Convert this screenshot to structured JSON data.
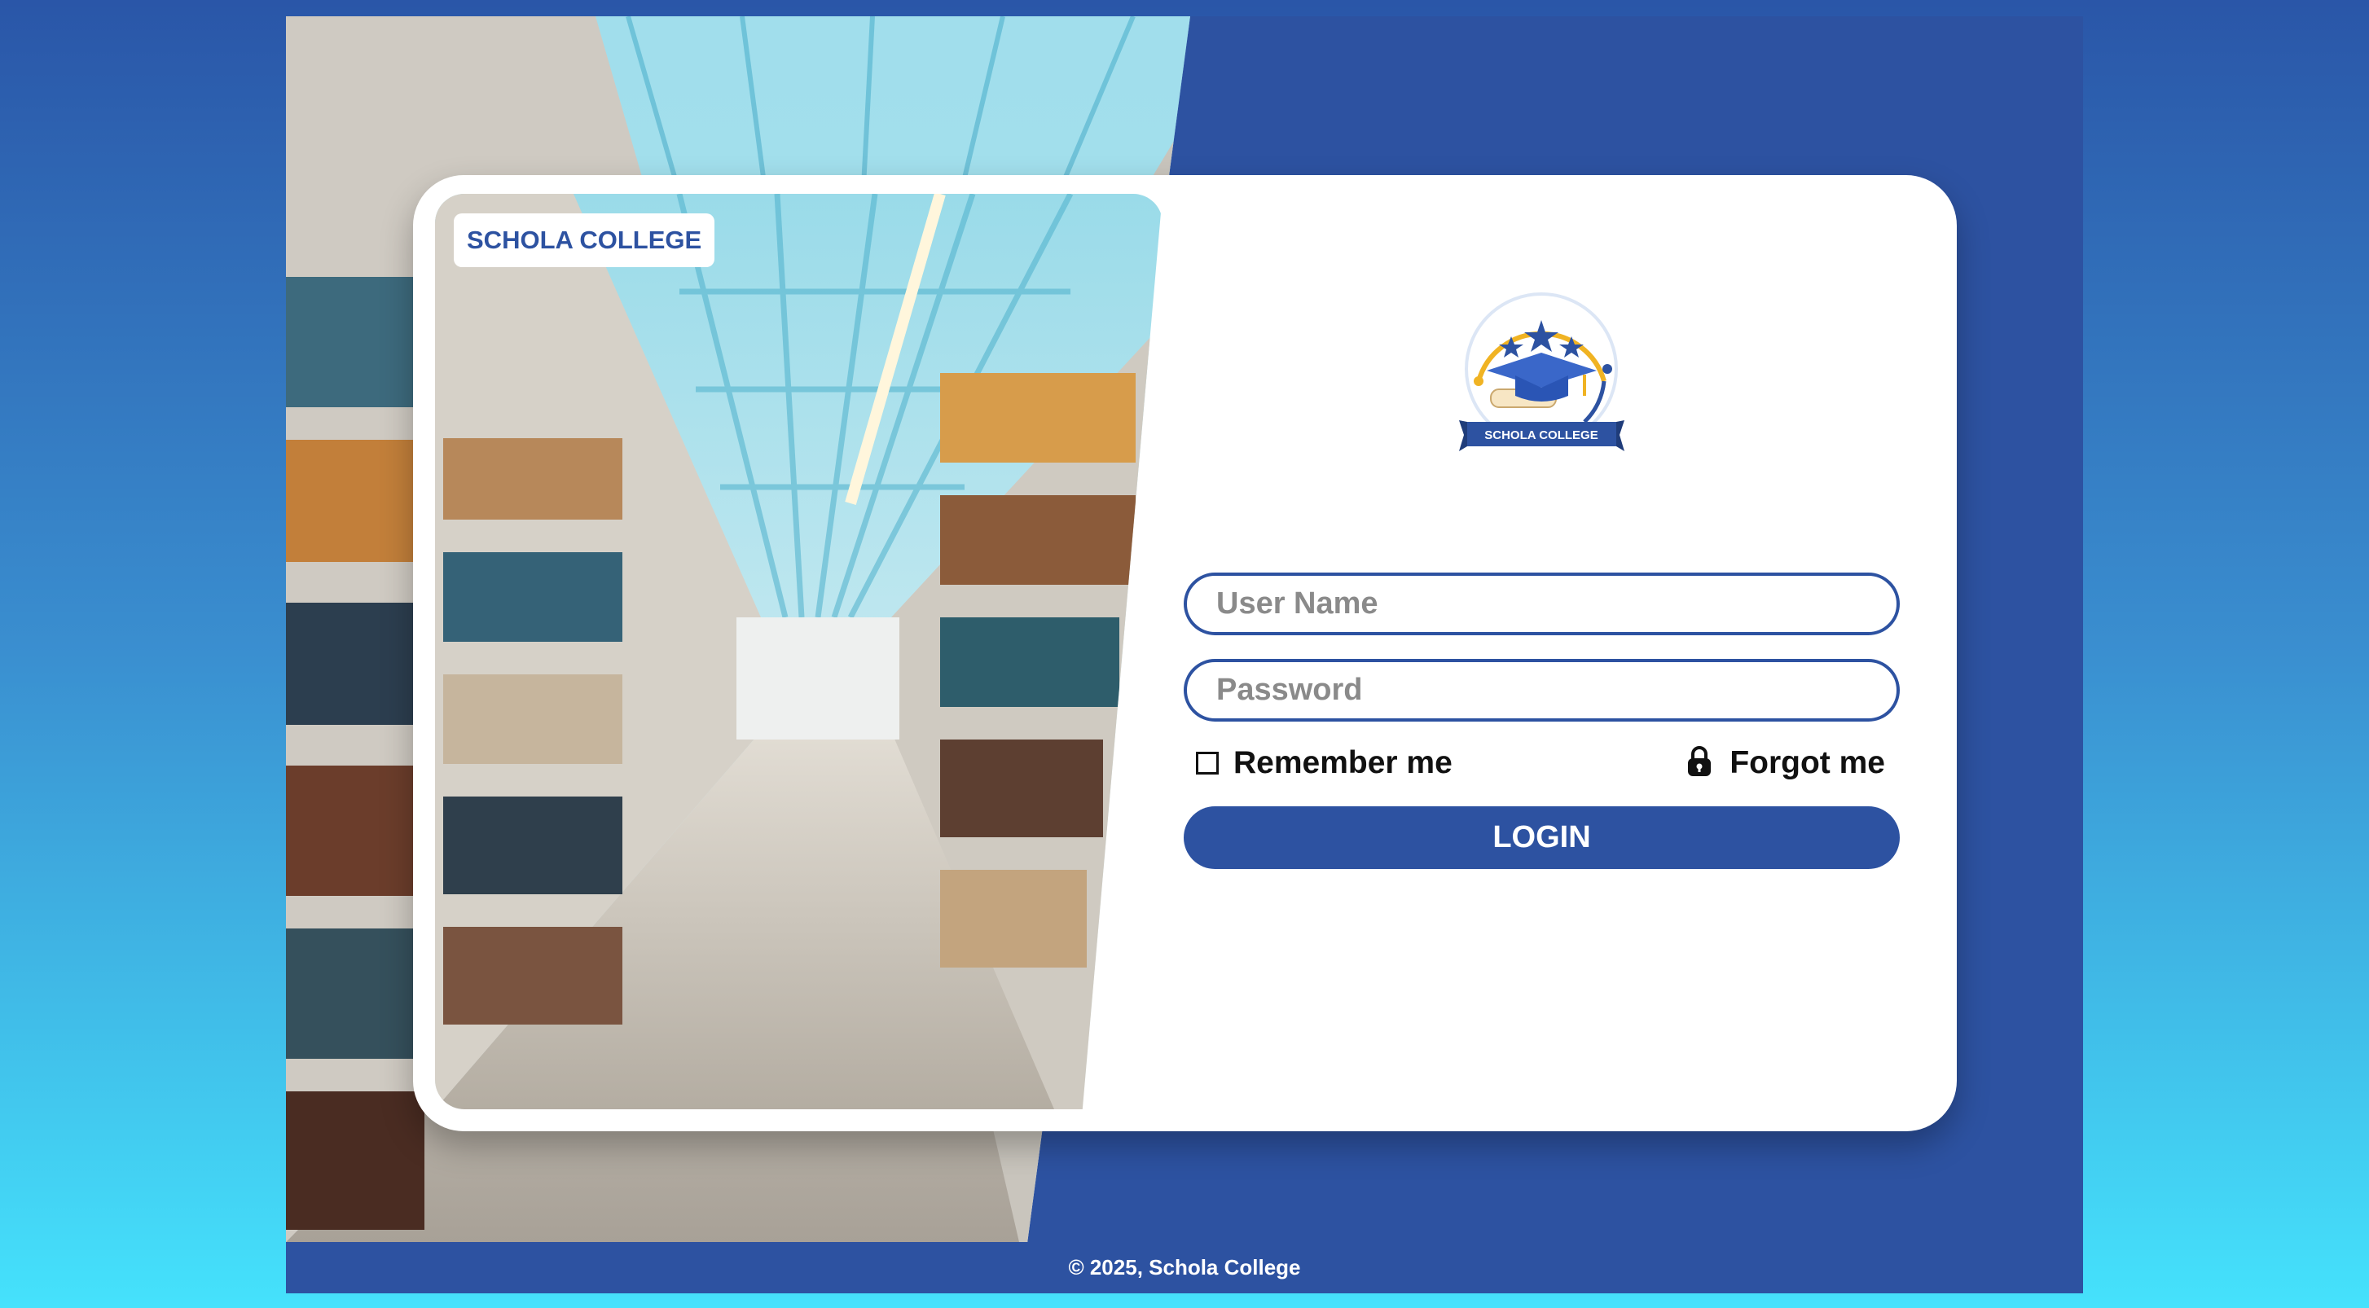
{
  "brand": {
    "badge_text": "SCHOLA COLLEGE",
    "logo_text": "SCHOLA COLLEGE",
    "primary_color": "#2d52a1",
    "accent_color": "#f0b323"
  },
  "login_form": {
    "username_placeholder": "User Name",
    "password_placeholder": "Password",
    "remember_label": "Remember me",
    "forgot_label": "Forgot me",
    "login_label": "LOGIN"
  },
  "icons": {
    "remember": "checkbox-icon",
    "forgot": "lock-icon"
  },
  "footer": {
    "copyright": "© 2025, Schola College"
  }
}
